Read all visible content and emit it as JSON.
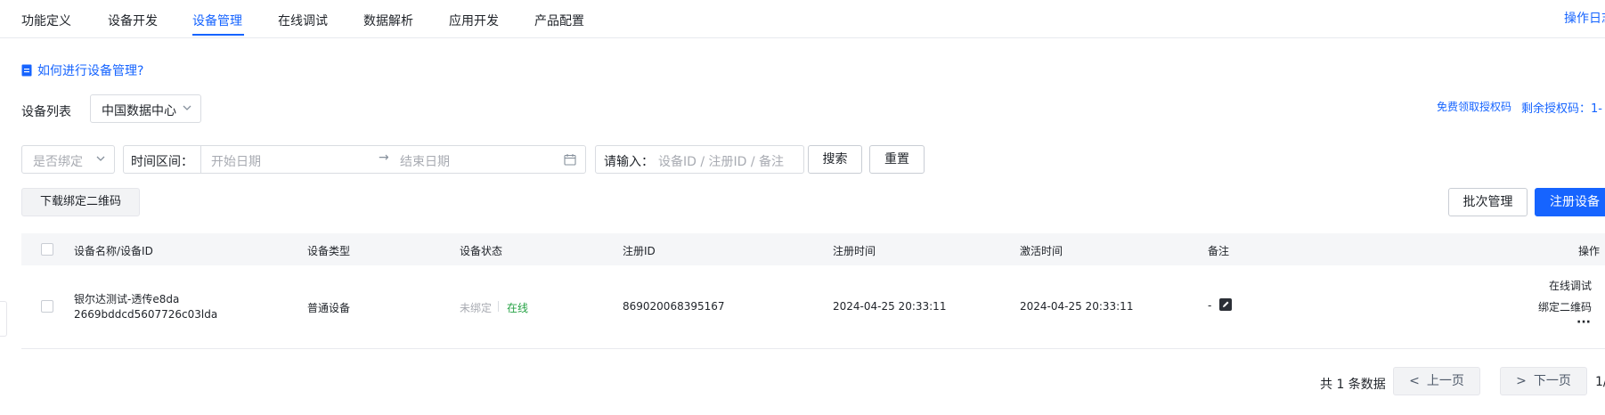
{
  "tabs": [
    "功能定义",
    "设备开发",
    "设备管理",
    "在线调试",
    "数据解析",
    "应用开发",
    "产品配置"
  ],
  "operation_log": "操作日志",
  "help_link": "如何进行设备管理?",
  "device_list": {
    "label": "设备列表",
    "region_select": "中国数据中心"
  },
  "auth": {
    "free_link": "免费领取授权码",
    "remaining": "剩余授权码：1-"
  },
  "filters": {
    "bind_select": "是否绑定",
    "time_range_label": "时间区间：",
    "start_placeholder": "开始日期",
    "end_placeholder": "结束日期",
    "search_label": "请输入：",
    "search_placeholder": "设备ID / 注册ID / 备注",
    "search_button": "搜索",
    "reset_button": "重置"
  },
  "buttons": {
    "download_qr": "下载绑定二维码",
    "batch_manage": "批次管理",
    "register_device": "注册设备"
  },
  "table": {
    "columns": [
      "设备名称/设备ID",
      "设备类型",
      "设备状态",
      "注册ID",
      "注册时间",
      "激活时间",
      "备注",
      "操作"
    ],
    "rows": [
      {
        "name": "银尔达测试-透传e8da",
        "id": "2669bddcd5607726c03lda",
        "type": "普通设备",
        "bind_status": "未绑定",
        "online_status": "在线",
        "register_id": "869020068395167",
        "register_time": "2024-04-25 20:33:11",
        "activate_time": "2024-04-25 20:33:11",
        "remark": "-",
        "actions": [
          "在线调试",
          "绑定二维码",
          "···"
        ]
      }
    ]
  },
  "pagination": {
    "total_text": "共 1 条数据",
    "prev": "上一页",
    "next": "下一页",
    "page": "1/"
  },
  "colors": {
    "primary": "#1664ff",
    "online": "#25a244",
    "header_bg": "#f5f6f8"
  }
}
